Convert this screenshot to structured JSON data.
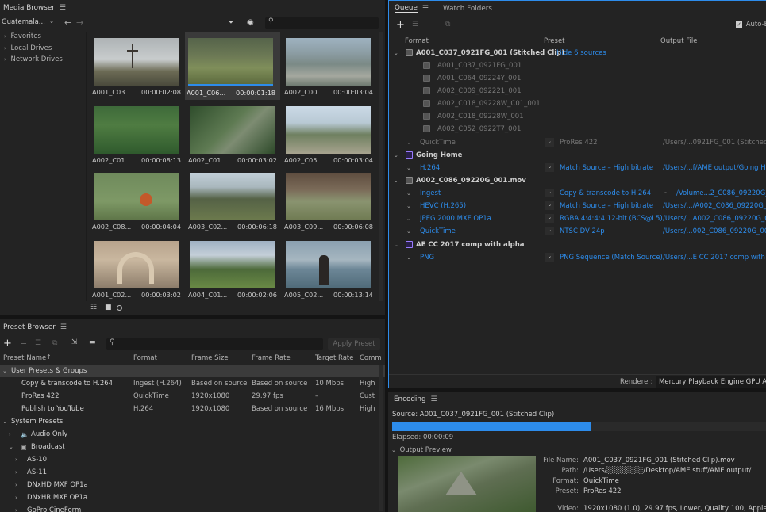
{
  "media_browser": {
    "title": "Media Browser",
    "location": "Guatemala...",
    "tree": [
      "Favorites",
      "Local Drives",
      "Network Drives"
    ],
    "thumbs": [
      {
        "name": "A001_C03...",
        "dur": "00:00:02:08"
      },
      {
        "name": "A001_C06...",
        "dur": "00:00:01:18"
      },
      {
        "name": "A002_C00...",
        "dur": "00:00:03:04"
      },
      {
        "name": "A002_C01...",
        "dur": "00:00:08:13"
      },
      {
        "name": "A002_C01...",
        "dur": "00:00:03:02"
      },
      {
        "name": "A002_C05...",
        "dur": "00:00:03:04"
      },
      {
        "name": "A002_C08...",
        "dur": "00:00:04:04"
      },
      {
        "name": "A003_C02...",
        "dur": "00:00:06:18"
      },
      {
        "name": "A003_C09...",
        "dur": "00:00:06:08"
      },
      {
        "name": "A001_C02...",
        "dur": "00:00:03:02"
      },
      {
        "name": "A004_C01...",
        "dur": "00:00:02:06"
      },
      {
        "name": "A005_C02...",
        "dur": "00:00:13:14"
      }
    ]
  },
  "preset_browser": {
    "title": "Preset Browser",
    "apply_label": "Apply Preset",
    "columns": [
      "Preset Name",
      "Format",
      "Frame Size",
      "Frame Rate",
      "Target Rate",
      "Comm"
    ],
    "user_group": "User Presets & Groups",
    "user_rows": [
      {
        "name": "Copy & transcode to H.264",
        "format": "Ingest (H.264)",
        "size": "Based on source",
        "rate": "Based on source",
        "target": "10 Mbps",
        "comm": "High"
      },
      {
        "name": "ProRes 422",
        "format": "QuickTime",
        "size": "1920x1080",
        "rate": "29.97 fps",
        "target": "–",
        "comm": "Cust"
      },
      {
        "name": "Publish to YouTube",
        "format": "H.264",
        "size": "1920x1080",
        "rate": "Based on source",
        "target": "16 Mbps",
        "comm": "High"
      }
    ],
    "system_group": "System Presets",
    "system_rows": [
      "Audio Only",
      "Broadcast",
      "AS-10",
      "AS-11",
      "DNxHD MXF OP1a",
      "DNxHR MXF OP1a",
      "GoPro CineForm"
    ]
  },
  "queue": {
    "tab_queue": "Queue",
    "tab_watch": "Watch Folders",
    "auto_label": "Auto-E",
    "columns": {
      "format": "Format",
      "preset": "Preset",
      "output": "Output File"
    },
    "groups": [
      {
        "title": "A001_C037_0921FG_001 (Stitched Clip)",
        "link": "Hide 6 sources"
      },
      {
        "title": "Going Home"
      },
      {
        "title": "A002_C086_09220G_001.mov"
      },
      {
        "title": "AE CC 2017 comp with alpha"
      }
    ],
    "sources": [
      "A001_C037_0921FG_001",
      "A001_C064_09224Y_001",
      "A002_C009_092221_001",
      "A002_C018_09228W_C01_001",
      "A002_C018_09228W_001",
      "A002_C052_0922T7_001"
    ],
    "items": [
      {
        "format": "QuickTime",
        "preset": "ProRes 422",
        "output": "/Users/...0921FG_001 (Stitched C"
      },
      {
        "format": "H.264",
        "preset": "Match Source – High bitrate",
        "output": "/Users/...f/AME output/Going Ho"
      },
      {
        "format": "Ingest",
        "preset": "Copy & transcode to H.264",
        "output": "/Volume...2_C086_09220G_0"
      },
      {
        "format": "HEVC (H.265)",
        "preset": "Match Source – High bitrate",
        "output": "/Users/.../A002_C086_09220G_00"
      },
      {
        "format": "JPEG 2000 MXF OP1a",
        "preset": "RGBA 4:4:4:4 12-bit (BCS@L5)",
        "output": "/Users/...A002_C086_09220G_00"
      },
      {
        "format": "QuickTime",
        "preset": "NTSC DV 24p",
        "output": "/Users/...002_C086_09220G_001"
      },
      {
        "format": "PNG",
        "preset": "PNG Sequence (Match Source)",
        "output": "/Users/...E CC 2017 comp with al"
      }
    ],
    "renderer_label": "Renderer:",
    "renderer_value": "Mercury Playback Engine GPU Acce"
  },
  "encoding": {
    "title": "Encoding",
    "source": "Source: A001_C037_0921FG_001 (Stitched Clip)",
    "progress": 0.53,
    "elapsed": "Elapsed: 00:00:09",
    "preview_label": "Output Preview",
    "fields": [
      {
        "label": "File Name:",
        "value": "A001_C037_0921FG_001 (Stitched Clip).mov"
      },
      {
        "label": "Path:",
        "value": "/Users/░░░░░░░/Desktop/AME stuff/AME output/"
      },
      {
        "label": "Format:",
        "value": "QuickTime"
      },
      {
        "label": "Preset:",
        "value": "ProRes 422"
      },
      {
        "label": "Video:",
        "value": "1920x1080 (1.0), 29.97 fps, Lower, Quality 100, Apple Pro"
      }
    ]
  },
  "colors": {
    "accent": "#2d8ceb",
    "panel": "#232323",
    "bg": "#1d1d1d"
  }
}
